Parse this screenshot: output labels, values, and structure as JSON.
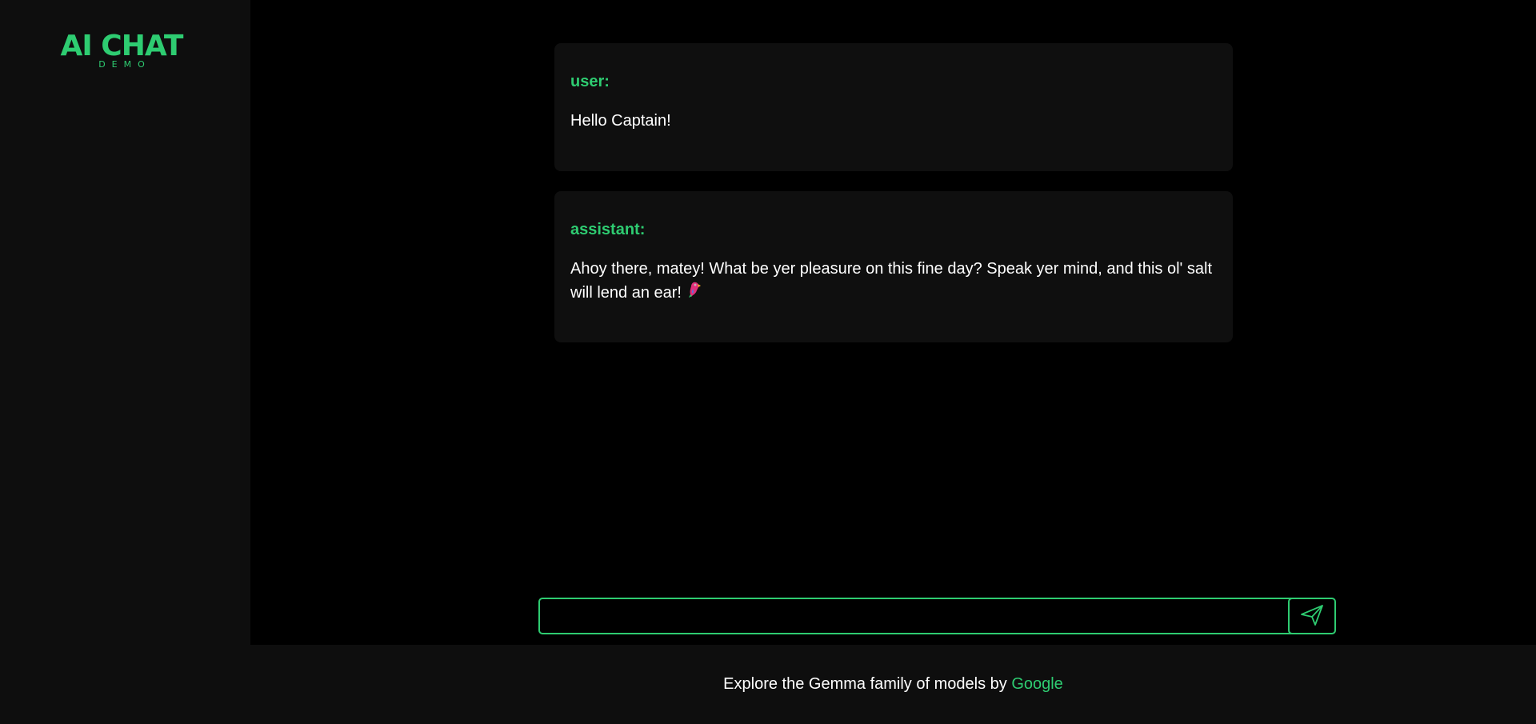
{
  "brand": {
    "title": "AI CHAT",
    "subtitle": "DEMO",
    "accent_color": "#2ecc71"
  },
  "messages": [
    {
      "role": "user:",
      "content": "Hello Captain!"
    },
    {
      "role": "assistant:",
      "content": "Ahoy there, matey! What be yer pleasure on this fine day? Speak yer mind, and this ol' salt will lend an ear!",
      "emoji": "parrot-icon"
    }
  ],
  "composer": {
    "value": "",
    "placeholder": "",
    "send_icon": "send-icon"
  },
  "footer": {
    "text": "Explore the Gemma family of models by ",
    "link_text": "Google"
  }
}
